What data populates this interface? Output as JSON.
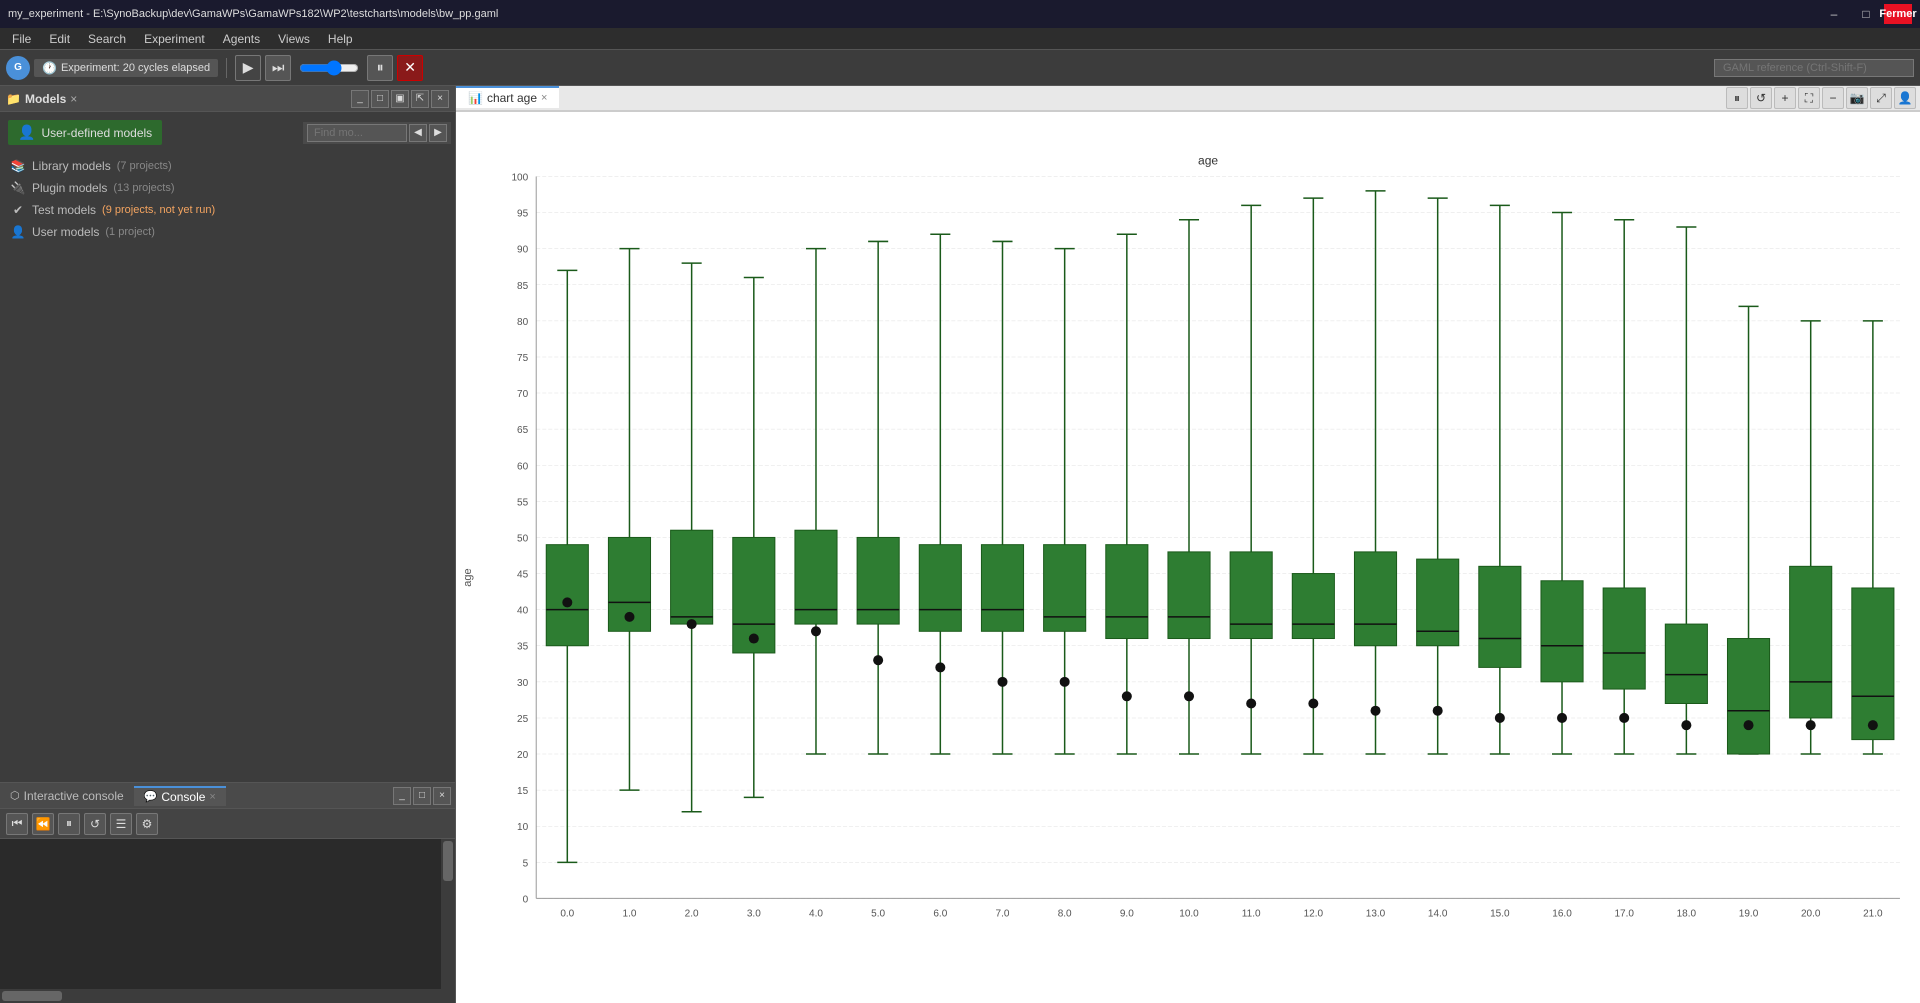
{
  "titlebar": {
    "title": "my_experiment - E:\\SynoBackup\\dev\\GamaWPs\\GamaWPs182\\WP2\\testcharts\\models\\bw_pp.gaml",
    "min_label": "–",
    "max_label": "□",
    "close_label": "Fermer"
  },
  "menubar": {
    "items": [
      "File",
      "Edit",
      "Search",
      "Experiment",
      "Agents",
      "Views",
      "Help"
    ]
  },
  "toolbar": {
    "experiment_label": "Experiment: 20 cycles elapsed",
    "play_label": "▶",
    "step_label": "⏭",
    "stop_label": "✕",
    "pause_label": "⏸",
    "reload_label": "↺",
    "search_placeholder": "GAML reference (Ctrl-Shift-F)"
  },
  "models_panel": {
    "title": "Models",
    "close_label": "×",
    "user_defined_label": "User-defined models",
    "find_placeholder": "Find mo...",
    "library_models": "Library models",
    "library_count": "(7 projects)",
    "plugin_models": "Plugin models",
    "plugin_count": "(13 projects)",
    "test_models": "Test models",
    "test_count": "(9 projects, not yet run)",
    "user_models": "User models",
    "user_count": "(1 project)"
  },
  "console_panel": {
    "interactive_console_label": "Interactive console",
    "console_label": "Console",
    "close_label": "×"
  },
  "chart": {
    "title": "chart age",
    "tab_close": "×",
    "y_axis_label": "age",
    "x_axis_label": "",
    "chart_inner_title": "age",
    "y_max": 100,
    "y_min": 0,
    "y_ticks": [
      100,
      95,
      90,
      85,
      80,
      75,
      70,
      65,
      60,
      55,
      50,
      45,
      40,
      35,
      30,
      25,
      20,
      15,
      10,
      5,
      0
    ],
    "x_labels": [
      "0.0",
      "1.0",
      "2.0",
      "3.0",
      "4.0",
      "5.0",
      "6.0",
      "7.0",
      "8.0",
      "9.0",
      "10.0",
      "11.0",
      "12.0",
      "13.0",
      "14.0",
      "15.0",
      "16.0",
      "17.0",
      "18.0",
      "19.0",
      "20.0",
      "21.0"
    ],
    "boxes": [
      {
        "x_label": "0.0",
        "q1": 35,
        "q3": 49,
        "min": 5,
        "max": 87,
        "median": 40,
        "mean": 41
      },
      {
        "x_label": "1.0",
        "q1": 37,
        "q3": 50,
        "min": 15,
        "max": 90,
        "median": 41,
        "mean": 39
      },
      {
        "x_label": "2.0",
        "q1": 38,
        "q3": 51,
        "min": 12,
        "max": 88,
        "median": 39,
        "mean": 38
      },
      {
        "x_label": "3.0",
        "q1": 34,
        "q3": 50,
        "min": 14,
        "max": 86,
        "median": 38,
        "mean": 36
      },
      {
        "x_label": "4.0",
        "q1": 38,
        "q3": 51,
        "min": 20,
        "max": 90,
        "median": 40,
        "mean": 37
      },
      {
        "x_label": "5.0",
        "q1": 38,
        "q3": 50,
        "min": 20,
        "max": 91,
        "median": 40,
        "mean": 33
      },
      {
        "x_label": "6.0",
        "q1": 37,
        "q3": 49,
        "min": 20,
        "max": 92,
        "median": 40,
        "mean": 32
      },
      {
        "x_label": "7.0",
        "q1": 37,
        "q3": 49,
        "min": 20,
        "max": 91,
        "median": 40,
        "mean": 30
      },
      {
        "x_label": "8.0",
        "q1": 37,
        "q3": 49,
        "min": 20,
        "max": 90,
        "median": 39,
        "mean": 30
      },
      {
        "x_label": "9.0",
        "q1": 36,
        "q3": 49,
        "min": 20,
        "max": 92,
        "median": 39,
        "mean": 28
      },
      {
        "x_label": "10.0",
        "q1": 36,
        "q3": 48,
        "min": 20,
        "max": 94,
        "median": 39,
        "mean": 28
      },
      {
        "x_label": "11.0",
        "q1": 36,
        "q3": 48,
        "min": 20,
        "max": 96,
        "median": 38,
        "mean": 27
      },
      {
        "x_label": "12.0",
        "q1": 36,
        "q3": 45,
        "min": 20,
        "max": 97,
        "median": 38,
        "mean": 27
      },
      {
        "x_label": "13.0",
        "q1": 35,
        "q3": 48,
        "min": 20,
        "max": 98,
        "median": 38,
        "mean": 26
      },
      {
        "x_label": "14.0",
        "q1": 35,
        "q3": 47,
        "min": 20,
        "max": 97,
        "median": 37,
        "mean": 26
      },
      {
        "x_label": "15.0",
        "q1": 32,
        "q3": 46,
        "min": 20,
        "max": 96,
        "median": 36,
        "mean": 25
      },
      {
        "x_label": "16.0",
        "q1": 30,
        "q3": 44,
        "min": 20,
        "max": 95,
        "median": 35,
        "mean": 25
      },
      {
        "x_label": "17.0",
        "q1": 29,
        "q3": 43,
        "min": 20,
        "max": 94,
        "median": 34,
        "mean": 25
      },
      {
        "x_label": "18.0",
        "q1": 27,
        "q3": 38,
        "min": 20,
        "max": 93,
        "median": 31,
        "mean": 24
      },
      {
        "x_label": "19.0",
        "q1": 20,
        "q3": 36,
        "min": 20,
        "max": 82,
        "median": 26,
        "mean": 24
      },
      {
        "x_label": "20.0",
        "q1": 25,
        "q3": 46,
        "min": 20,
        "max": 80,
        "median": 30,
        "mean": 24
      },
      {
        "x_label": "21.0",
        "q1": 22,
        "q3": 43,
        "min": 20,
        "max": 80,
        "median": 28,
        "mean": 24
      }
    ]
  }
}
